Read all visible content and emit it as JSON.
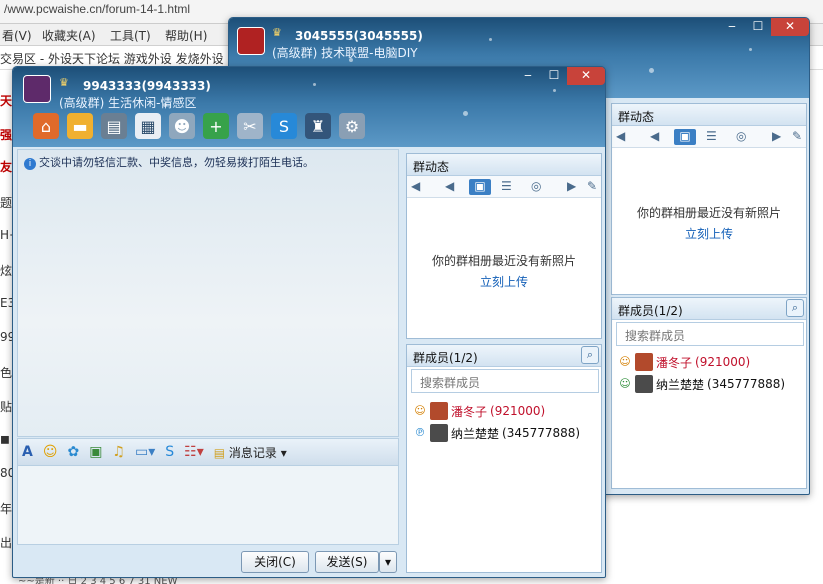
{
  "browser": {
    "address": "www.pcwaishe.cn/forum-14-1.html",
    "menu": [
      "看(V)",
      "收藏夹(A)",
      "工具(T)",
      "帮助(H)"
    ],
    "favorites": "交易区 - 外设天下论坛 游戏外设 发烧外设",
    "left_edge": [
      "天下",
      "强区",
      "友最",
      "题",
      "H+",
      "炫问",
      "E3.",
      "99",
      "色",
      "贴",
      "◼",
      "80",
      "年",
      "出"
    ],
    "bottom": "~~是新 ‧‧ 日 2 3 4 5 6 7 31 NEW"
  },
  "back_window": {
    "name": "3045555(3045555)",
    "subtitle": "(高级群) 技术联盟-电脑DIY",
    "group_news": {
      "title": "群动态",
      "empty": "你的群相册最近没有新照片",
      "upload": "立刻上传"
    },
    "members": {
      "title": "群成员(1/2)",
      "search_placeholder": "搜索群成员",
      "list": [
        {
          "name": "潘冬子",
          "id": "(921000)"
        },
        {
          "name": "纳兰楚楚",
          "id": "(345777888)"
        }
      ]
    }
  },
  "front_window": {
    "name": "9943333(9943333)",
    "subtitle": "(高级群) 生活休闲-情感区",
    "notice": "交谈中请勿轻信汇款、中奖信息，勿轻易拨打陌生电话。",
    "message_log": "消息记录",
    "close_btn": "关闭(C)",
    "send_btn": "发送(S)",
    "group_news": {
      "title": "群动态",
      "empty": "你的群相册最近没有新照片",
      "upload": "立刻上传"
    },
    "members": {
      "title": "群成员(1/2)",
      "search_placeholder": "搜索群成员",
      "list": [
        {
          "name": "潘冬子",
          "id": "(921000)"
        },
        {
          "name": "纳兰楚楚",
          "id": "(345777888)"
        }
      ]
    }
  },
  "icons": {
    "toolbar": [
      "home-icon",
      "folder-icon",
      "film-icon",
      "card-icon",
      "people-icon",
      "add-app-icon",
      "tools-icon",
      "skype-icon",
      "officer-icon",
      "gear-icon"
    ],
    "input_toolbar": [
      "font-icon",
      "smiley-icon",
      "emoji-icon",
      "image-icon",
      "music-icon",
      "screenshot-icon",
      "skype-icon",
      "apps-icon"
    ]
  }
}
